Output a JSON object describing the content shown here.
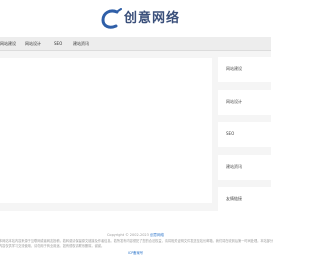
{
  "header": {
    "logo_text": "创意网络",
    "brand_color": "#3a4f7a",
    "logo_icon": "c-swoosh-icon"
  },
  "nav": {
    "items": [
      {
        "label": "网站建设"
      },
      {
        "label": "网站设计"
      },
      {
        "label": "SEO"
      },
      {
        "label": "建站资讯"
      }
    ]
  },
  "sidebar": {
    "items": [
      {
        "label": "网站建设"
      },
      {
        "label": "网站设计"
      },
      {
        "label": "SEO"
      },
      {
        "label": "建站资讯"
      },
      {
        "label": "友情链接"
      }
    ]
  },
  "footer": {
    "copyright_prefix": "Copyright © 2002-2023",
    "site_name": "创意网络",
    "description": "本网站本站内容来源于互联网或者网友投稿，若转载请保留原文链接及作者信息。若所发布内容侵犯了您的合法权益，请将相关证明文件发送至站长邮箱，我们将在收到后第一时间处理。本站部分内容仅供学习交流使用，请勿用于商业用途。如有侵权请联系删除，谢谢。",
    "icp": "ICP备案号"
  }
}
